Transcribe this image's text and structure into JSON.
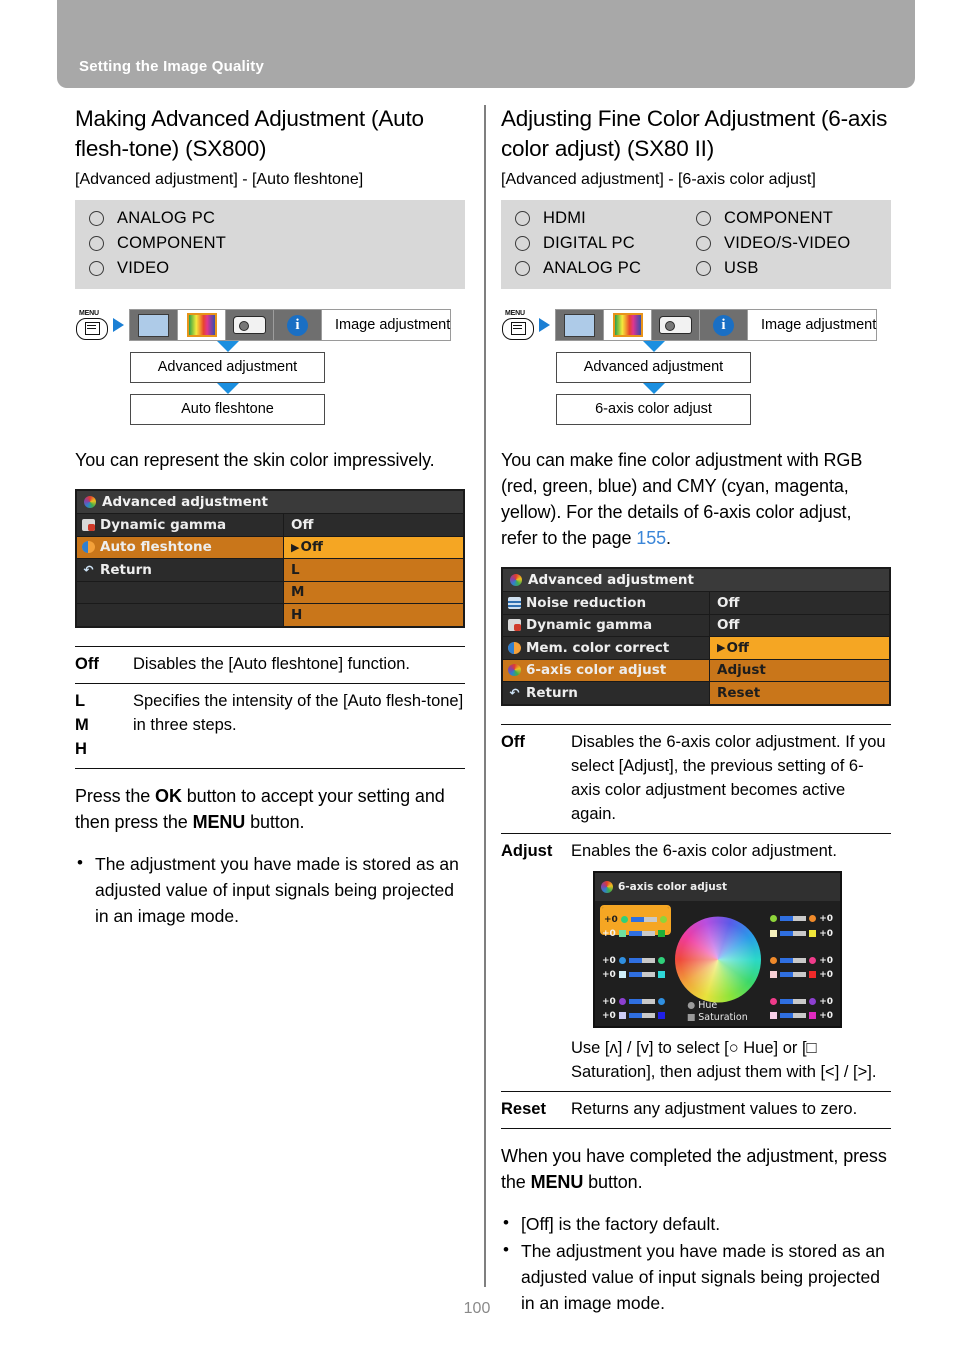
{
  "header": {
    "title": "Setting the Image Quality"
  },
  "page_number": "100",
  "left": {
    "section_title": "Making Advanced Adjustment (Auto flesh-tone) (SX800)",
    "subtitle": "[Advanced adjustment] - [Auto fleshtone]",
    "signals": [
      "ANALOG PC",
      "COMPONENT",
      "VIDEO"
    ],
    "menu_path": {
      "menu_button_label": "MENU",
      "tab_title": "Image adjustment",
      "step1": "Advanced adjustment",
      "step2": "Auto fleshtone"
    },
    "intro": "You can represent the skin color impressively.",
    "osd": {
      "title": "Advanced adjustment",
      "rows": [
        {
          "label": "Dynamic gamma",
          "value": "Off"
        },
        {
          "label": "Auto fleshtone",
          "value": "Off"
        },
        {
          "label": "Return",
          "value": "L"
        },
        {
          "label": "",
          "value": "M"
        },
        {
          "label": "",
          "value": "H"
        }
      ]
    },
    "table": [
      {
        "key": "Off",
        "value": "Disables the [Auto fleshtone] function."
      },
      {
        "key": "L\nM\nH",
        "value": "Specifies the intensity of the [Auto flesh-tone] in three steps."
      }
    ],
    "table_keys_multi": [
      "L",
      "M",
      "H"
    ],
    "note_paragraph": "Press the OK button to accept your setting and then press the MENU button.",
    "note_ok": "OK",
    "note_menu": "MENU",
    "bullets": [
      "The adjustment you have made is stored as an adjusted value of input signals being projected in an image mode."
    ]
  },
  "right": {
    "section_title": "Adjusting Fine Color Adjustment (6-axis color adjust) (SX80 II)",
    "subtitle": "[Advanced adjustment] - [6-axis color adjust]",
    "signals_col1": [
      "HDMI",
      "DIGITAL PC",
      "ANALOG PC"
    ],
    "signals_col2": [
      "COMPONENT",
      "VIDEO/S-VIDEO",
      "USB"
    ],
    "menu_path": {
      "menu_button_label": "MENU",
      "tab_title": "Image adjustment",
      "step1": "Advanced adjustment",
      "step2": "6-axis color adjust"
    },
    "intro_part1": "You can make fine color adjustment with RGB (red, green, blue) and CMY (cyan, magenta, yellow). For the details of 6-axis color adjust, refer to the page ",
    "intro_link": "155",
    "intro_part2": ".",
    "osd": {
      "title": "Advanced adjustment",
      "rows": [
        {
          "label": "Noise reduction",
          "value": "Off"
        },
        {
          "label": "Dynamic gamma",
          "value": "Off"
        },
        {
          "label": "Mem. color correct",
          "value": "Off"
        },
        {
          "label": "6-axis color adjust",
          "value": "Adjust"
        },
        {
          "label": "Return",
          "value": "Reset"
        }
      ]
    },
    "table": [
      {
        "key": "Off",
        "value": "Disables the 6-axis color adjustment. If you select [Adjust], the previous setting of 6-axis color adjustment becomes active again."
      },
      {
        "key": "Adjust",
        "value": "Enables the 6-axis color adjustment."
      },
      {
        "key": "Reset",
        "value": "Returns any adjustment values to zero."
      }
    ],
    "axis_osd": {
      "title": "6-axis color adjust",
      "values": [
        "+0",
        "+0",
        "+0",
        "+0",
        "+0",
        "+0",
        "+0",
        "+0",
        "+0",
        "+0",
        "+0",
        "+0"
      ],
      "legend_hue": "Hue",
      "legend_saturation": "Saturation"
    },
    "axis_caption": "Use [ʌ] / [v] to select [○ Hue] or [□ Saturation], then adjust them with [<] / [>].",
    "closing_paragraph": "When you have completed the adjustment, press the MENU button.",
    "closing_menu": "MENU",
    "bullets": [
      "[Off] is the factory default.",
      "The adjustment you have made is stored as an adjusted value of input signals being projected in an image mode."
    ]
  },
  "colors": {
    "header_bg": "#a8a8a8",
    "signal_bg": "#d8d8d8",
    "link": "#3b86d8",
    "osd_highlight": "#f5a623",
    "osd_dim": "#c9761a",
    "arrow_blue": "#1b8fe0"
  }
}
